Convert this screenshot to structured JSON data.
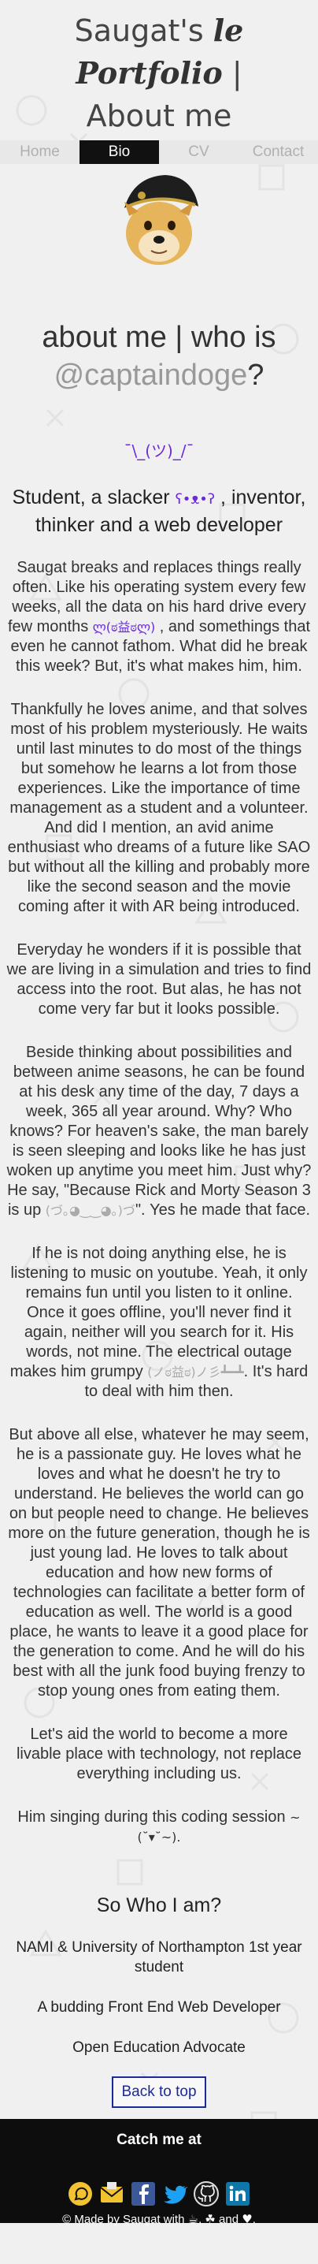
{
  "header": {
    "title_pre": "Saugat's ",
    "title_script": "le Portfolio",
    "title_post": " |",
    "subtitle": "About me"
  },
  "nav": {
    "tabs": [
      {
        "label": "Home",
        "active": false
      },
      {
        "label": "Bio",
        "active": true
      },
      {
        "label": "CV",
        "active": false
      },
      {
        "label": "Contact",
        "active": false
      }
    ]
  },
  "about": {
    "heading_pre": "about me | who is",
    "handle": "@captaindoge",
    "heading_post": "?",
    "shrug": "¯\\_(ツ)_/¯",
    "tagline_pre": "Student, a slacker ",
    "tagline_kao": "ʕ•ᴥ•ʔ",
    "tagline_post": " , inventor, thinker and a web developer"
  },
  "bio": {
    "p1_a": "Saugat breaks and replaces things really often. Like his operating system every few weeks, all the data on his hard drive every few months ",
    "p1_kao": "ლ(ಠ益ಠლ)",
    "p1_b": " , and somethings that even he cannot fathom. What did he break this week? But, it's what makes him, him.",
    "p2": "Thankfully he loves anime, and that solves most of his problem mysteriously. He waits until last minutes to do most of the things but somehow he learns a lot from those experiences. Like the importance of time management as a student and a volunteer. And did I mention, an avid anime enthusiast who dreams of a future like SAO but without all the killing and probably more like the second season and the movie coming after it with AR being introduced.",
    "p3": "Everyday he wonders if it is possible that we are living in a simulation and tries to find access into the root. But alas, he has not come very far but it looks possible.",
    "p4_a": "Beside thinking about possibilities and between anime seasons, he can be found at his desk any time of the day, 7 days a week, 365 all year around. Why? Who knows? For heaven's sake, the man barely is seen sleeping and looks like he has just woken up anytime you meet him. Just why? He say, \"Because Rick and Morty Season 3 is up ",
    "p4_kao": "(づ｡◕‿‿◕｡)づ",
    "p4_b": "\". Yes he made that face.",
    "p5_a": "If he is not doing anything else, he is listening to music on youtube. Yeah, it only remains fun until you listen to it online. Once it goes offline, you'll never find it again, neither will you search for it. His words, not mine. The electrical outage makes him grumpy ",
    "p5_kao": "(ノಠ益ಠ)ノ彡┻━┻",
    "p5_b": ". It's hard to deal with him then.",
    "p6": "But above all else, whatever he may seem, he is a passionate guy. He loves what he loves and what he doesn't he try to understand. He believes the world can go on but people need to change. He believes more on the future generation, though he is just young lad. He loves to talk about education and how new forms of technologies can facilitate a better form of education as well. The world is a good place, he wants to leave it a good place for the generation to come. And he will do his best with all the junk food buying frenzy to stop young ones from eating them.",
    "p7": "Let's aid the world to become a more livable place with technology, not replace everything including us.",
    "p8_a": "Him singing during this coding session ",
    "p8_kao": "~(˘▾˘~)."
  },
  "who": {
    "heading": "So Who I am?",
    "lines": [
      "NAMI & University of Northampton 1st year student",
      "A budding Front End Web Developer",
      "Open Education Advocate"
    ],
    "back_to_top": "Back to top"
  },
  "footer": {
    "catch": "Catch me at",
    "icons": [
      "whatsapp-icon",
      "mail-icon",
      "facebook-icon",
      "twitter-icon",
      "github-icon",
      "linkedin-icon"
    ],
    "made_a": "© Made by Saugat with ",
    "made_b": ", ",
    "made_c": " and ",
    "made_d": "."
  },
  "colors": {
    "accent_purple": "#6a2bd8",
    "link_blue": "#1a2a9a",
    "active_tab": "#111111"
  }
}
